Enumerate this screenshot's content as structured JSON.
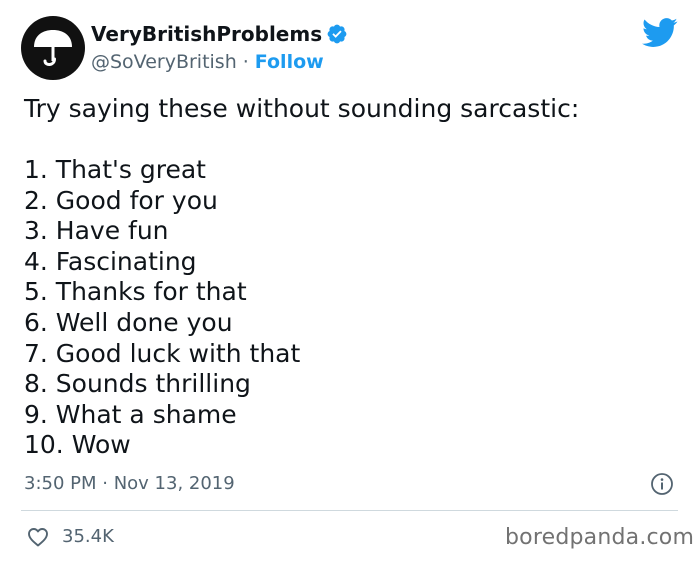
{
  "author": {
    "display_name": "VeryBritishProblems",
    "handle": "@SoVeryBritish",
    "separator": "·",
    "follow_label": "Follow",
    "avatar_icon": "umbrella-logo",
    "verified_icon": "verified-badge-icon"
  },
  "tweet": {
    "intro": "Try saying these without sounding sarcastic:",
    "items": [
      "1. That's great",
      "2. Good for you",
      "3. Have fun",
      "4. Fascinating",
      "5. Thanks for that",
      "6. Well done you",
      "7. Good luck with that",
      "8. Sounds thrilling",
      "9. What a shame",
      "10. Wow"
    ],
    "timestamp": "3:50 PM · Nov 13, 2019",
    "like_count": "35.4K"
  },
  "icons": {
    "brand": "twitter-bird-icon",
    "info": "info-icon",
    "like": "heart-icon"
  },
  "watermark": "boredpanda.com",
  "colors": {
    "accent": "#1d9bf0",
    "text": "#0f1419",
    "muted": "#536471",
    "divider": "#cfd9de",
    "watermark": "#727272"
  }
}
